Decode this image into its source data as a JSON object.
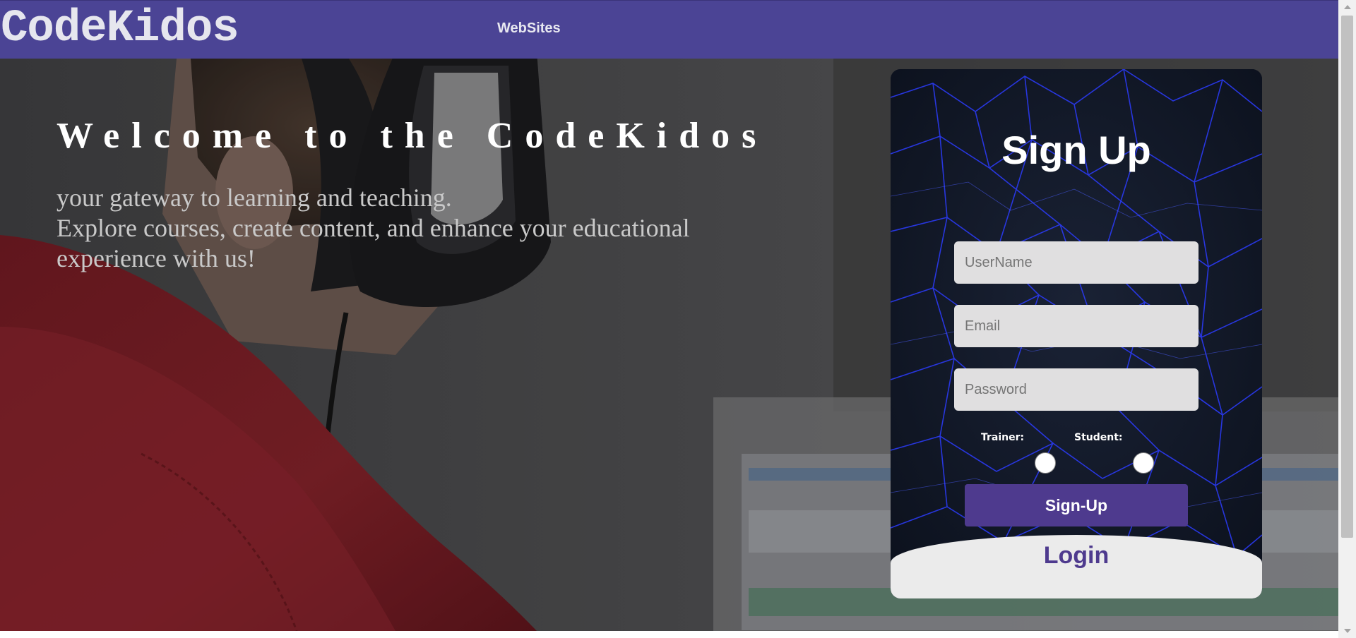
{
  "header": {
    "brand": "CodeKidos",
    "nav_link": "WebSites"
  },
  "hero": {
    "title": "Welcome to the CodeKidos",
    "tagline_lines": [
      "your gateway to learning and teaching.",
      "Explore courses, create content, and enhance your educational",
      "experience with us!"
    ]
  },
  "signup": {
    "title": "Sign Up",
    "username_placeholder": "UserName",
    "email_placeholder": "Email",
    "password_placeholder": "Password",
    "role_trainer_label": "Trainer:",
    "role_student_label": "Student:",
    "submit_label": "Sign-Up",
    "login_label": "Login"
  },
  "colors": {
    "header_bg": "#4b4495",
    "accent_purple": "#4e3a8e",
    "field_bg": "#e0dfe0"
  },
  "icons": {
    "scroll_up": "triangle-up-icon",
    "scroll_down": "triangle-down-icon"
  }
}
